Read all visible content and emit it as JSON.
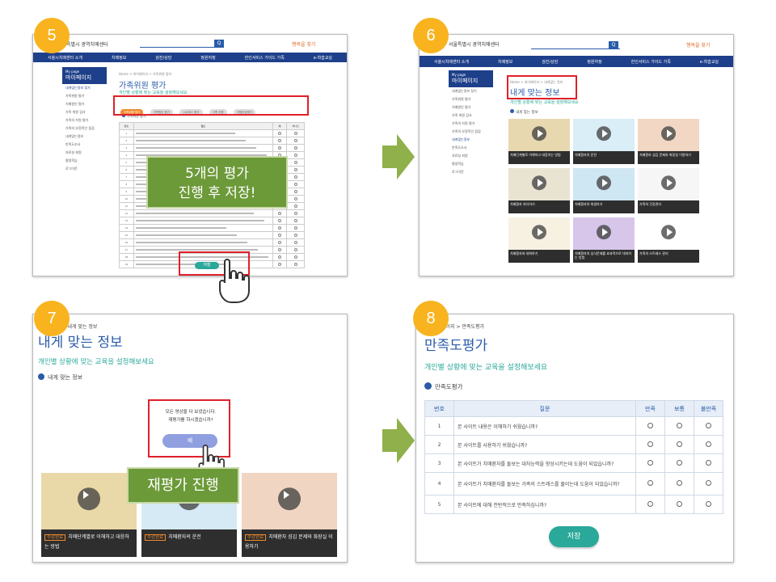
{
  "steps": {
    "s5": "5",
    "s6": "6",
    "s7": "7",
    "s8": "8"
  },
  "site": {
    "logo": "서울특별시 광역치매센터",
    "search_btn": "Q",
    "brand": "행복을 찾기",
    "nav": [
      "서울시치매센터 소개",
      "치매정보",
      "검진/상담",
      "정원여정",
      "한인서비스 가이드 가족",
      "e-학습교실"
    ],
    "sidebar_title_small": "My page",
    "sidebar_title": "마이페이지",
    "sidebar_items": [
      "내게맞는정보 찾기",
      "가족위원 평가",
      "치매원인 평가",
      "가족 위원 검사",
      "가족의 자원 평가",
      "가족의 부정적인 점검",
      "내게맞는정보",
      "만족도조사",
      "자료실 회원",
      "평생학습",
      "로그아웃"
    ]
  },
  "panel5": {
    "breadcrumb": "Home > 마이페이지 > 가족위원 평가",
    "title": "가족위원 평가",
    "subtitle": "개인별 상황에 맞는 교육을 설정해보세요",
    "chips": [
      "가족위원 평가",
      "가족원인 평가",
      "스트레스 평가",
      "가족 자원",
      "자원부정평가"
    ],
    "section": "가족위원 평가",
    "table_header": [
      "번호",
      "질문",
      "예",
      "아니오"
    ],
    "row_count": 19,
    "save": "저장",
    "callout_line1": "5개의 평가",
    "callout_line2": "진행 후 저장!"
  },
  "panel6": {
    "breadcrumb": "Home > 마이페이지 > 내게맞는 정보",
    "title": "내게 맞는 정보",
    "subtitle": "개인별 상황에 맞는 교육을 설정해보세요",
    "section": "내게 맞는 정보",
    "captions": [
      "치매단계별로 이해하고 대응하는 방법",
      "치매환자의 운전",
      "치매환자 섬김 문제와 화장실 이용하기",
      "치매환자 외식하기",
      "치매환자의 위생하기",
      "가족의 건강관리",
      "치매환자와 대화하기",
      "치매환자의 섭식문제를 효과적으로 대처하는 방법",
      "가족의 스트레스 관리"
    ]
  },
  "panel7": {
    "breadcrumb": "마이페이지 > 내게 맞는 정보",
    "title": "내게 맞는 정보",
    "subtitle": "개인별 상황에 맞는 교육을 설정해보세요",
    "section": "내게 맞는 정보",
    "dialog_line1": "모든 영상을 다 보셨습니다.",
    "dialog_line2": "재평가를 하시겠습니까?",
    "yes": "예",
    "callout": "재평가 진행",
    "tag": "수강완료",
    "captions": [
      "치매단계별로 이해하고 대응하는 방법",
      "치매환자의 운전",
      "치매환자 섬김 문제와 화장실 이용하기"
    ]
  },
  "panel8": {
    "breadcrumb": "마이페이지 > 만족도평가",
    "title": "만족도평가",
    "subtitle": "개인별 상황에 맞는 교육을 설정해보세요",
    "section": "만족도평가",
    "headers": [
      "번호",
      "질문",
      "만족",
      "보통",
      "불만족"
    ],
    "rows": [
      {
        "no": "1",
        "q": "본 사이트 내용은 이해하기 쉬웠습니까?"
      },
      {
        "no": "2",
        "q": "본 사이트를 사용하기 쉬웠습니까?"
      },
      {
        "no": "3",
        "q": "본 사이트가 치매환자를 돌보는 대처능력을 향상시키는데 도움이 되었습니까?"
      },
      {
        "no": "4",
        "q": "본 사이트가 치매환자를 돌보는 가족의 스트레스를 줄이는데 도움이 되었습니까?"
      },
      {
        "no": "5",
        "q": "본 사이트에 대해 전반적으로 만족하십니까?"
      }
    ],
    "save": "저장"
  },
  "colors": {
    "badge": "#f8b31e",
    "arrow": "#8fb04a",
    "callout": "#6c9a39",
    "nav": "#1e3f8a",
    "highlight": "#e0202a",
    "teal_button": "#2aa89a"
  }
}
